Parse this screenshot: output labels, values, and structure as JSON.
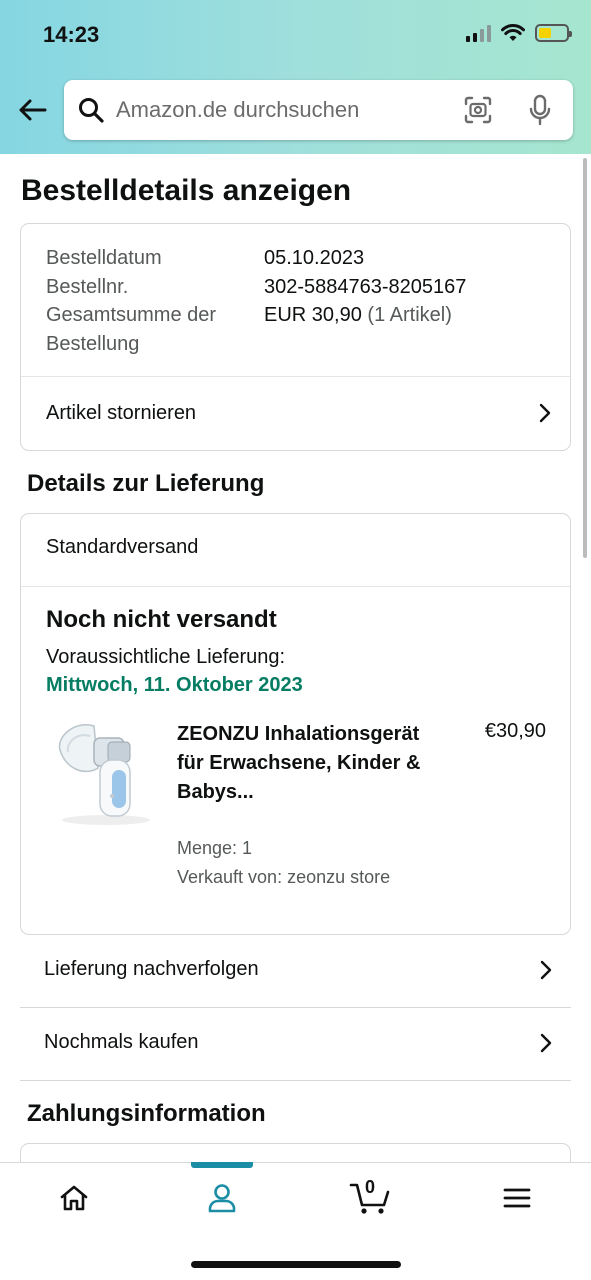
{
  "status_bar": {
    "time": "14:23"
  },
  "search": {
    "placeholder": "Amazon.de durchsuchen"
  },
  "page": {
    "title": "Bestelldetails anzeigen"
  },
  "order": {
    "date_label": "Bestelldatum",
    "date_value": "05.10.2023",
    "number_label": "Bestellnr.",
    "number_value": "302-5884763-8205167",
    "total_label_line1": "Gesamtsumme der",
    "total_label_line2": "Bestellung",
    "total_value": "EUR 30,90",
    "total_items": "(1 Artikel)",
    "cancel_label": "Artikel stornieren"
  },
  "delivery": {
    "section_title": "Details zur Lieferung",
    "shipping_method": "Standardversand",
    "status": "Noch nicht versandt",
    "eta_label": "Voraussichtliche Lieferung:",
    "eta_date": "Mittwoch, 11. Oktober 2023",
    "product": {
      "name": "ZEONZU Inhalationsgerät für Erwachsene, Kinder & Babys...",
      "price": "€30,90",
      "quantity": "Menge: 1",
      "seller": "Verkauft von: zeonzu store"
    },
    "track_label": "Lieferung nachverfolgen",
    "buy_again_label": "Nochmals kaufen"
  },
  "payment": {
    "section_title": "Zahlungsinformation"
  },
  "bottom_nav": {
    "items": [
      "home-icon",
      "account-icon",
      "cart-icon",
      "menu-icon"
    ],
    "active": "account-icon",
    "cart_count": "0"
  },
  "colors": {
    "accent": "#1b8ea5",
    "delivery_green": "#067d62"
  }
}
